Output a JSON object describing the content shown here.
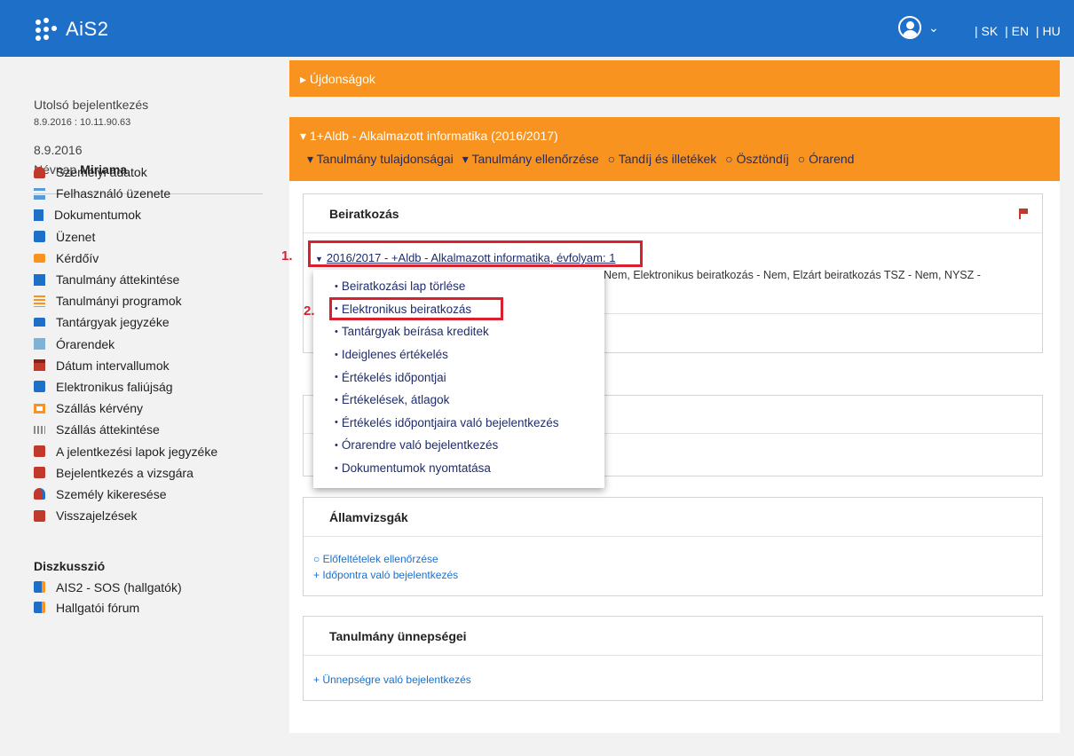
{
  "header": {
    "app_name": "AiS2",
    "languages": [
      "| SK",
      "| EN",
      "| HU"
    ],
    "chevron": "⌄"
  },
  "sidebar": {
    "last_login_label": "Utolsó bejelentkezés",
    "last_login_time": "8.9.2016 : 10.11.90.63",
    "date": "8.9.2016",
    "nameday_label": "Névnap",
    "nameday_name": "Miriama",
    "menu": [
      {
        "label": "Személyi adatok",
        "icon": "person-icon",
        "color": "#c0392b"
      },
      {
        "label": "Felhasználó üzenete",
        "icon": "org-chart-icon",
        "color": "#5b9bd5"
      },
      {
        "label": "Dokumentumok",
        "icon": "document-icon",
        "color": "#1e6fc8"
      },
      {
        "label": "Üzenet",
        "icon": "message-icon",
        "color": "#1e6fc8"
      },
      {
        "label": "Kérdőív",
        "icon": "briefcase-icon",
        "color": "#f7931e"
      },
      {
        "label": "Tanulmány áttekintése",
        "icon": "book-icon",
        "color": "#1e6fc8"
      },
      {
        "label": "Tanulmányi programok",
        "icon": "list-icon",
        "color": "#f7931e"
      },
      {
        "label": "Tantárgyak jegyzéke",
        "icon": "books-icon",
        "color": "#1e6fc8"
      },
      {
        "label": "Órarendek",
        "icon": "timetable-icon",
        "color": "#7fb3d5"
      },
      {
        "label": "Dátum intervallumok",
        "icon": "calendar-icon",
        "color": "#c0392b"
      },
      {
        "label": "Elektronikus faliújság",
        "icon": "e-board-icon",
        "color": "#1e6fc8"
      },
      {
        "label": "Szállás kérvény",
        "icon": "monitor-icon",
        "color": "#f7931e"
      },
      {
        "label": "Szállás áttekintése",
        "icon": "grid-icon",
        "color": "#888888"
      },
      {
        "label": "A jelentkezési lapok jegyzéke",
        "icon": "form-icon",
        "color": "#c0392b"
      },
      {
        "label": "Bejelentkezés a vizsgára",
        "icon": "exam-icon",
        "color": "#c0392b"
      },
      {
        "label": "Személy kikeresése",
        "icon": "person-search-icon",
        "color": "#c0392b"
      },
      {
        "label": "Visszajelzések",
        "icon": "feedback-icon",
        "color": "#c0392b"
      }
    ],
    "discussion_title": "Diszkusszió",
    "discussion": [
      {
        "label": "AIS2 - SOS (hallgatók)",
        "icon": "chat-icon"
      },
      {
        "label": "Hallgatói fórum",
        "icon": "chat-icon"
      }
    ]
  },
  "main": {
    "news_bar": "▸ Újdonságok",
    "course_title": "▾ 1+Aldb - Alkalmazott informatika (2016/2017)",
    "course_links": [
      "▾ Tanulmány tulajdonságai",
      "▾ Tanulmány ellenőrzése",
      "○ Tandíj és illetékek",
      "○ Ösztöndíj",
      "○ Órarend"
    ],
    "enrollment": {
      "title": "Beiratkozás",
      "study_link": "2016/2017 - +Aldb - Alkalmazott informatika, évfolyam: 1",
      "study_info": "Nem, Elektronikus beiratkozás - Nem, Elzárt beiratkozás TSZ - Nem, NYSZ -"
    },
    "dropdown": [
      "Beiratkozási lap törlése",
      "Elektronikus beiratkozás",
      "Tantárgyak beírása kreditek",
      "Ideiglenes értékelés",
      "Értékelés időpontjai",
      "Értékelések, átlagok",
      "Értékelés időpontjaira való bejelentkezés",
      "Órarendre való bejelentkezés",
      "Dokumentumok nyomtatása"
    ],
    "state_exams": {
      "title": "Államvizsgák",
      "links": [
        "○ Előfeltételek ellenőrzése",
        "+ Időpontra való bejelentkezés"
      ]
    },
    "ceremonies": {
      "title": "Tanulmány ünnepségei",
      "links": [
        "+ Ünnepségre való bejelentkezés"
      ]
    },
    "step_labels": [
      "1.",
      "2."
    ]
  },
  "colors": {
    "header_blue": "#1e6fc8",
    "orange": "#f7931e",
    "highlight_red": "#d9202e",
    "link_navy": "#1f2d6d"
  }
}
